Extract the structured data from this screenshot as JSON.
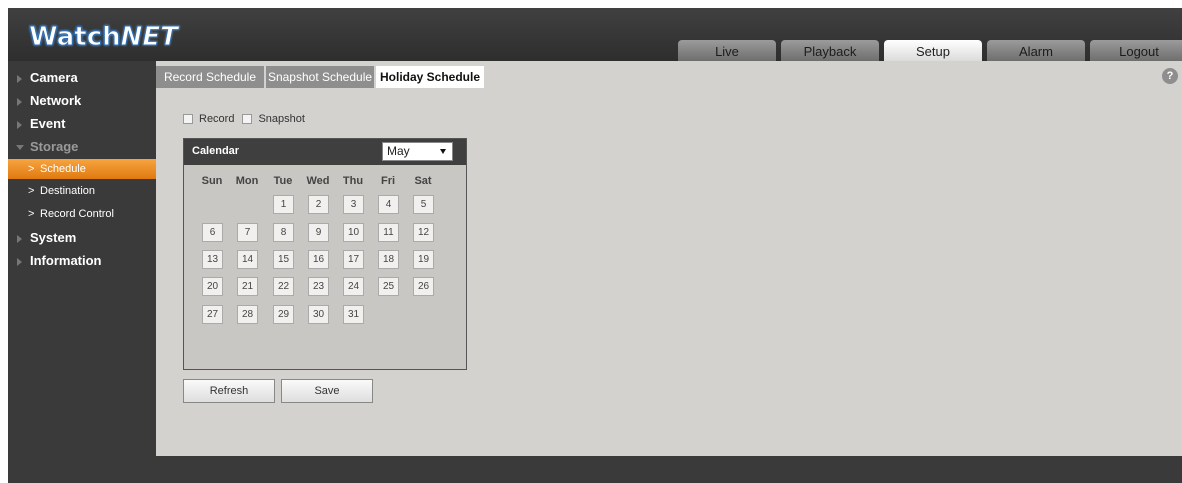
{
  "header": {
    "logo_left": "Watch",
    "logo_right": "NET",
    "tabs": [
      {
        "label": "Live"
      },
      {
        "label": "Playback"
      },
      {
        "label": "Setup"
      },
      {
        "label": "Alarm"
      },
      {
        "label": "Logout"
      }
    ],
    "active_tab": "Setup"
  },
  "sidebar": {
    "items": [
      {
        "label": "Camera"
      },
      {
        "label": "Network"
      },
      {
        "label": "Event"
      },
      {
        "label": "Storage"
      },
      {
        "label": "Schedule"
      },
      {
        "label": "Destination"
      },
      {
        "label": "Record Control"
      },
      {
        "label": "System"
      },
      {
        "label": "Information"
      }
    ],
    "active_item": "Schedule",
    "chevron": ">"
  },
  "main": {
    "subtabs": [
      {
        "label": "Record Schedule"
      },
      {
        "label": "Snapshot Schedule"
      },
      {
        "label": "Holiday Schedule"
      }
    ],
    "active_subtab": "Holiday Schedule",
    "help": "?",
    "checkboxes": [
      {
        "label": "Record",
        "checked": false
      },
      {
        "label": "Snapshot",
        "checked": false
      }
    ],
    "calendar": {
      "title": "Calendar",
      "month": "May",
      "weekdays": [
        "Sun",
        "Mon",
        "Tue",
        "Wed",
        "Thu",
        "Fri",
        "Sat"
      ],
      "days": [
        "1",
        "2",
        "3",
        "4",
        "5",
        "6",
        "7",
        "8",
        "9",
        "10",
        "11",
        "12",
        "13",
        "14",
        "15",
        "16",
        "17",
        "18",
        "19",
        "20",
        "21",
        "22",
        "23",
        "24",
        "25",
        "26",
        "27",
        "28",
        "29",
        "30",
        "31"
      ]
    },
    "buttons": {
      "refresh": "Refresh",
      "save": "Save"
    }
  },
  "colors": {
    "accent": "#f08a1c",
    "frame": "#3a3a3a",
    "content_bg": "#d4d2cf"
  }
}
